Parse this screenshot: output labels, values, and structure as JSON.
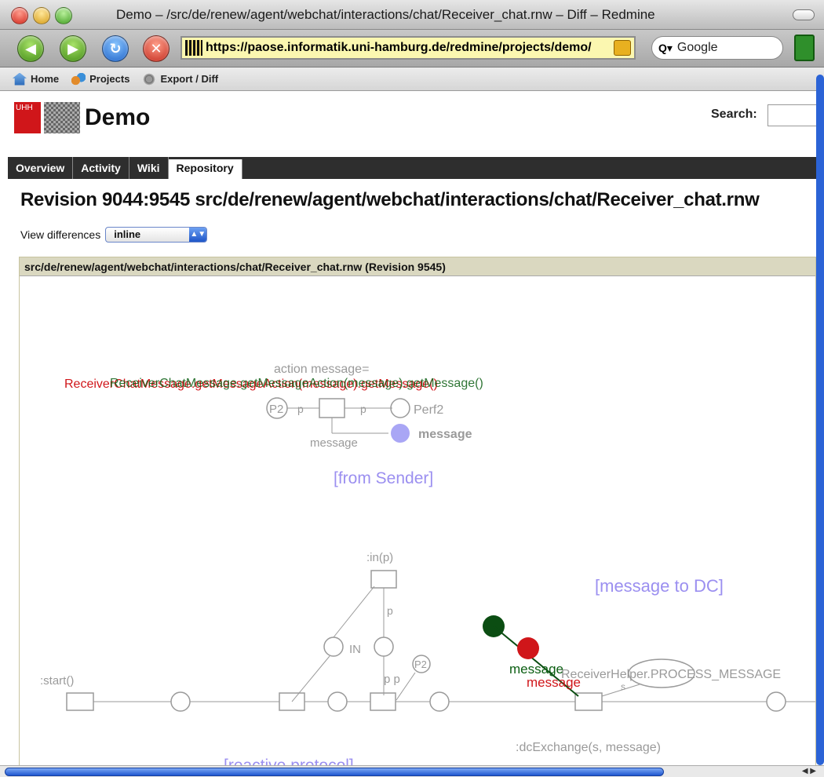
{
  "window": {
    "title": "Demo – /src/de/renew/agent/webchat/interactions/chat/Receiver_chat.rnw – Diff – Redmine"
  },
  "toolbar": {
    "url": "https://paose.informatik.uni-hamburg.de/redmine/projects/demo/",
    "search_engine": "Google"
  },
  "bookmarks": [
    {
      "label": "Home",
      "icon": "home-icon"
    },
    {
      "label": "Projects",
      "icon": "projects-icon"
    },
    {
      "label": "Export / Diff",
      "icon": "export-icon"
    }
  ],
  "header": {
    "project_title": "Demo",
    "logo_text": "UHH",
    "search_label": "Search:"
  },
  "tabs": [
    {
      "label": "Overview",
      "active": false
    },
    {
      "label": "Activity",
      "active": false
    },
    {
      "label": "Wiki",
      "active": false
    },
    {
      "label": "Repository",
      "active": true
    }
  ],
  "main": {
    "heading": "Revision 9044:9545 src/de/renew/agent/webchat/interactions/chat/Receiver_chat.rnw",
    "view_differences_label": "View differences",
    "view_differences_value": "inline",
    "diff_file_header": "src/de/renew/agent/webchat/interactions/chat/Receiver_chat.rnw (Revision 9545)"
  },
  "diagram": {
    "action_label": "action message=",
    "overlap_green": "ReceiverChatMessage.getMessageAction(message).getMessage()",
    "overlap_red": "ReceiverChatMessage.getMessageAction(message).getMessage()",
    "p2_label": "P2",
    "p_label": "p",
    "perf2_label": "Perf2",
    "message_label": "message",
    "message_place_label": "message",
    "from_sender": "[from Sender]",
    "in_p": ":in(p)",
    "in_label": "IN",
    "p_label2": "p",
    "pp_label": "p p",
    "p2_label2": "P2",
    "message_to_dc": "[message to DC]",
    "start_label": ":start()",
    "green_message": "message",
    "red_message": "message",
    "receiver_helper": "ReceiverHelper.PROCESS_MESSAGE",
    "s_label": "s",
    "dc_exchange": ":dcExchange(s, message)",
    "reactive_protocol": "[reactive protocol]",
    "colors": {
      "added": "#d0161a",
      "removed": "#0b5e12",
      "unchanged": "#9a9a9a",
      "comment": "#9b8ff0"
    }
  }
}
